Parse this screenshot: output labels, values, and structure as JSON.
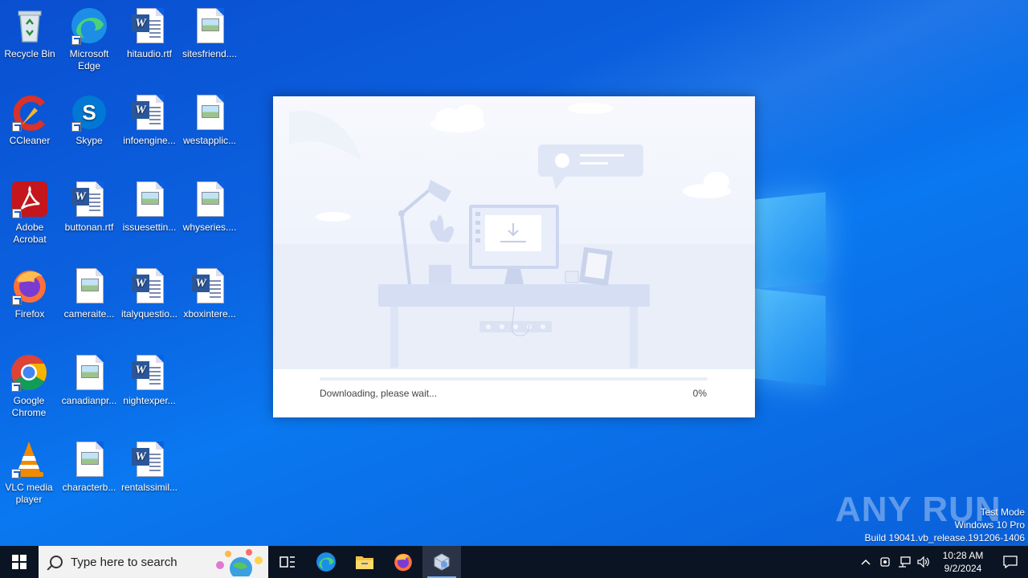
{
  "desktop": {
    "icons": [
      {
        "label": "Recycle Bin",
        "icon": "recycle-bin-icon"
      },
      {
        "label": "Microsoft Edge",
        "icon": "edge-icon"
      },
      {
        "label": "hitaudio.rtf",
        "icon": "word-doc-icon"
      },
      {
        "label": "sitesfriend....",
        "icon": "image-doc-icon"
      },
      {
        "label": "CCleaner",
        "icon": "ccleaner-icon"
      },
      {
        "label": "Skype",
        "icon": "skype-icon"
      },
      {
        "label": "infoengine...",
        "icon": "word-doc-icon"
      },
      {
        "label": "westapplic...",
        "icon": "image-doc-icon"
      },
      {
        "label": "Adobe Acrobat",
        "icon": "acrobat-icon"
      },
      {
        "label": "buttonan.rtf",
        "icon": "word-doc-icon"
      },
      {
        "label": "issuesettin...",
        "icon": "image-doc-icon"
      },
      {
        "label": "whyseries....",
        "icon": "image-doc-icon"
      },
      {
        "label": "Firefox",
        "icon": "firefox-icon"
      },
      {
        "label": "cameraite...",
        "icon": "image-doc-icon"
      },
      {
        "label": "italyquestio...",
        "icon": "word-doc-icon"
      },
      {
        "label": "xboxintere...",
        "icon": "word-doc-icon"
      },
      {
        "label": "Google Chrome",
        "icon": "chrome-icon"
      },
      {
        "label": "canadianpr...",
        "icon": "image-doc-icon"
      },
      {
        "label": "nightexper...",
        "icon": "word-doc-icon"
      },
      {
        "label": "VLC media player",
        "icon": "vlc-icon"
      },
      {
        "label": "characterb...",
        "icon": "image-doc-icon"
      },
      {
        "label": "rentalssimil...",
        "icon": "word-doc-icon"
      }
    ]
  },
  "installer": {
    "status_text": "Downloading, please wait...",
    "progress_label": "0%",
    "progress_value": 0
  },
  "watermark": {
    "brand": "ANY RUN",
    "line1": "Test Mode",
    "line2": "Windows 10 Pro",
    "line3": "Build 19041.vb_release.191206-1406"
  },
  "taskbar": {
    "search_placeholder": "Type here to search",
    "pinned": [
      "task-view-icon",
      "edge-icon",
      "file-explorer-icon",
      "firefox-icon",
      "installer-app-icon"
    ],
    "clock_time": "10:28 AM",
    "clock_date": "9/2/2024"
  },
  "colors": {
    "desktop_blue": "#0b62e0",
    "taskbar": "#0b1422",
    "progress": "#5b8ef0"
  }
}
